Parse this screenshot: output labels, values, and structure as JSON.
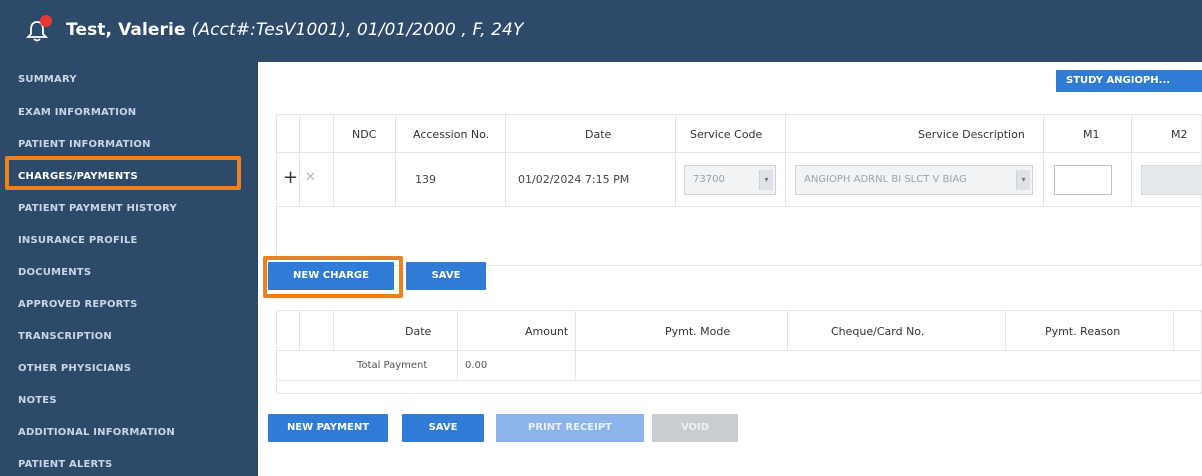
{
  "header": {
    "name": "Test, Valerie",
    "details": "(Acct#:TesV1001), 01/01/2000 , F, 24Y",
    "alert_color": "#e53935"
  },
  "sidebar": {
    "items": [
      {
        "label": "SUMMARY"
      },
      {
        "label": "EXAM INFORMATION"
      },
      {
        "label": "PATIENT INFORMATION"
      },
      {
        "label": "CHARGES/PAYMENTS",
        "active": true
      },
      {
        "label": "PATIENT PAYMENT HISTORY"
      },
      {
        "label": "INSURANCE PROFILE"
      },
      {
        "label": "DOCUMENTS"
      },
      {
        "label": "APPROVED REPORTS"
      },
      {
        "label": "TRANSCRIPTION"
      },
      {
        "label": "OTHER PHYSICIANS"
      },
      {
        "label": "NOTES"
      },
      {
        "label": "ADDITIONAL INFORMATION"
      },
      {
        "label": "PATIENT ALERTS"
      }
    ]
  },
  "main": {
    "study_badge": "STUDY  ANGIOPH..."
  },
  "charges": {
    "headers": {
      "ndc": "NDC",
      "accession": "Accession No.",
      "date": "Date",
      "service_code": "Service Code",
      "service_description": "Service Description",
      "m1": "M1",
      "m2": "M2"
    },
    "row": {
      "accession": "139",
      "date": "01/02/2024 7:15 PM",
      "service_code": "73700",
      "service_description": "ANGIOPH ADRNL BI SLCT V BIAG"
    },
    "new_charge_label": "NEW CHARGE",
    "save_label": "SAVE"
  },
  "payments": {
    "headers": {
      "date": "Date",
      "amount": "Amount",
      "mode": "Pymt. Mode",
      "cheque": "Cheque/Card No.",
      "reason": "Pymt. Reason"
    },
    "total_label": "Total Payment",
    "total_value": "0.00",
    "new_payment_label": "NEW PAYMENT",
    "save_label": "SAVE",
    "print_receipt_label": "PRINT RECEIPT",
    "void_label": "VOID"
  },
  "colors": {
    "sidebar_bg": "#2d4a6b",
    "accent_blue": "#2f7bd6",
    "highlight_orange": "#f07f1e"
  }
}
